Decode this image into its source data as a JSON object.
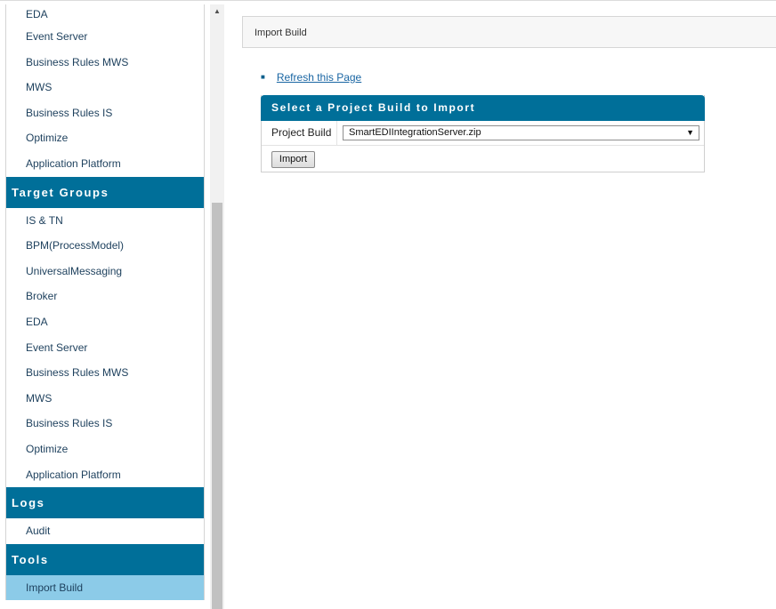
{
  "sidebar": {
    "top_items": [
      {
        "label": "EDA"
      },
      {
        "label": "Event Server"
      },
      {
        "label": "Business Rules MWS"
      },
      {
        "label": "MWS"
      },
      {
        "label": "Business Rules IS"
      },
      {
        "label": "Optimize"
      },
      {
        "label": "Application Platform"
      }
    ],
    "target_groups": {
      "title": "Target Groups",
      "items": [
        {
          "label": "IS & TN"
        },
        {
          "label": "BPM(ProcessModel)"
        },
        {
          "label": "UniversalMessaging"
        },
        {
          "label": "Broker"
        },
        {
          "label": "EDA"
        },
        {
          "label": "Event Server"
        },
        {
          "label": "Business Rules MWS"
        },
        {
          "label": "MWS"
        },
        {
          "label": "Business Rules IS"
        },
        {
          "label": "Optimize"
        },
        {
          "label": "Application Platform"
        }
      ]
    },
    "logs": {
      "title": "Logs",
      "items": [
        {
          "label": "Audit"
        }
      ]
    },
    "tools": {
      "title": "Tools",
      "items": [
        {
          "label": "Import Build",
          "active": true
        }
      ]
    }
  },
  "main": {
    "page_title": "Import Build",
    "refresh_link": "Refresh this Page",
    "panel": {
      "title": "Select a Project Build to Import",
      "project_build_label": "Project Build",
      "project_build_value": "SmartEDIIntegrationServer.zip",
      "import_button": "Import"
    }
  },
  "colors": {
    "header_blue": "#006f99",
    "active_item": "#8ccbe8",
    "link": "#1a66a3"
  },
  "icons": {
    "scroll_up": "triangle-up",
    "select_arrow": "triangle-down",
    "bullet": "square-bullet"
  }
}
